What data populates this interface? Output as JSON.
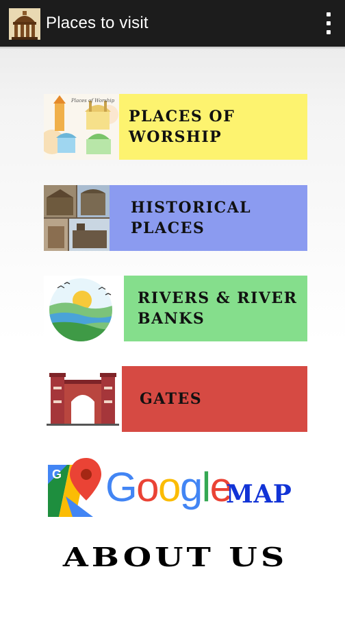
{
  "app_bar": {
    "title": "Places to visit",
    "app_icon": "temple-icon",
    "menu_icon": "overflow-menu-icon"
  },
  "tiles": [
    {
      "label": "PLACES OF WORSHIP",
      "color": "#fdf36f",
      "thumb_caption": "Places of Worship"
    },
    {
      "label": "HISTORICAL PLACES",
      "color": "#8b9bf0"
    },
    {
      "label": "RIVERS & RIVER BANKS",
      "color": "#85de8c"
    },
    {
      "label": "GATES",
      "color": "#d64a43"
    }
  ],
  "maps_banner": {
    "google_letters": [
      {
        "ch": "G",
        "color": "#4285f4"
      },
      {
        "ch": "o",
        "color": "#ea4335"
      },
      {
        "ch": "o",
        "color": "#fbbc05"
      },
      {
        "ch": "g",
        "color": "#4285f4"
      },
      {
        "ch": "l",
        "color": "#34a853"
      },
      {
        "ch": "e",
        "color": "#ea4335"
      }
    ],
    "map_label": "MAP",
    "map_color": "#1133d6"
  },
  "about_label": "ABOUT US"
}
